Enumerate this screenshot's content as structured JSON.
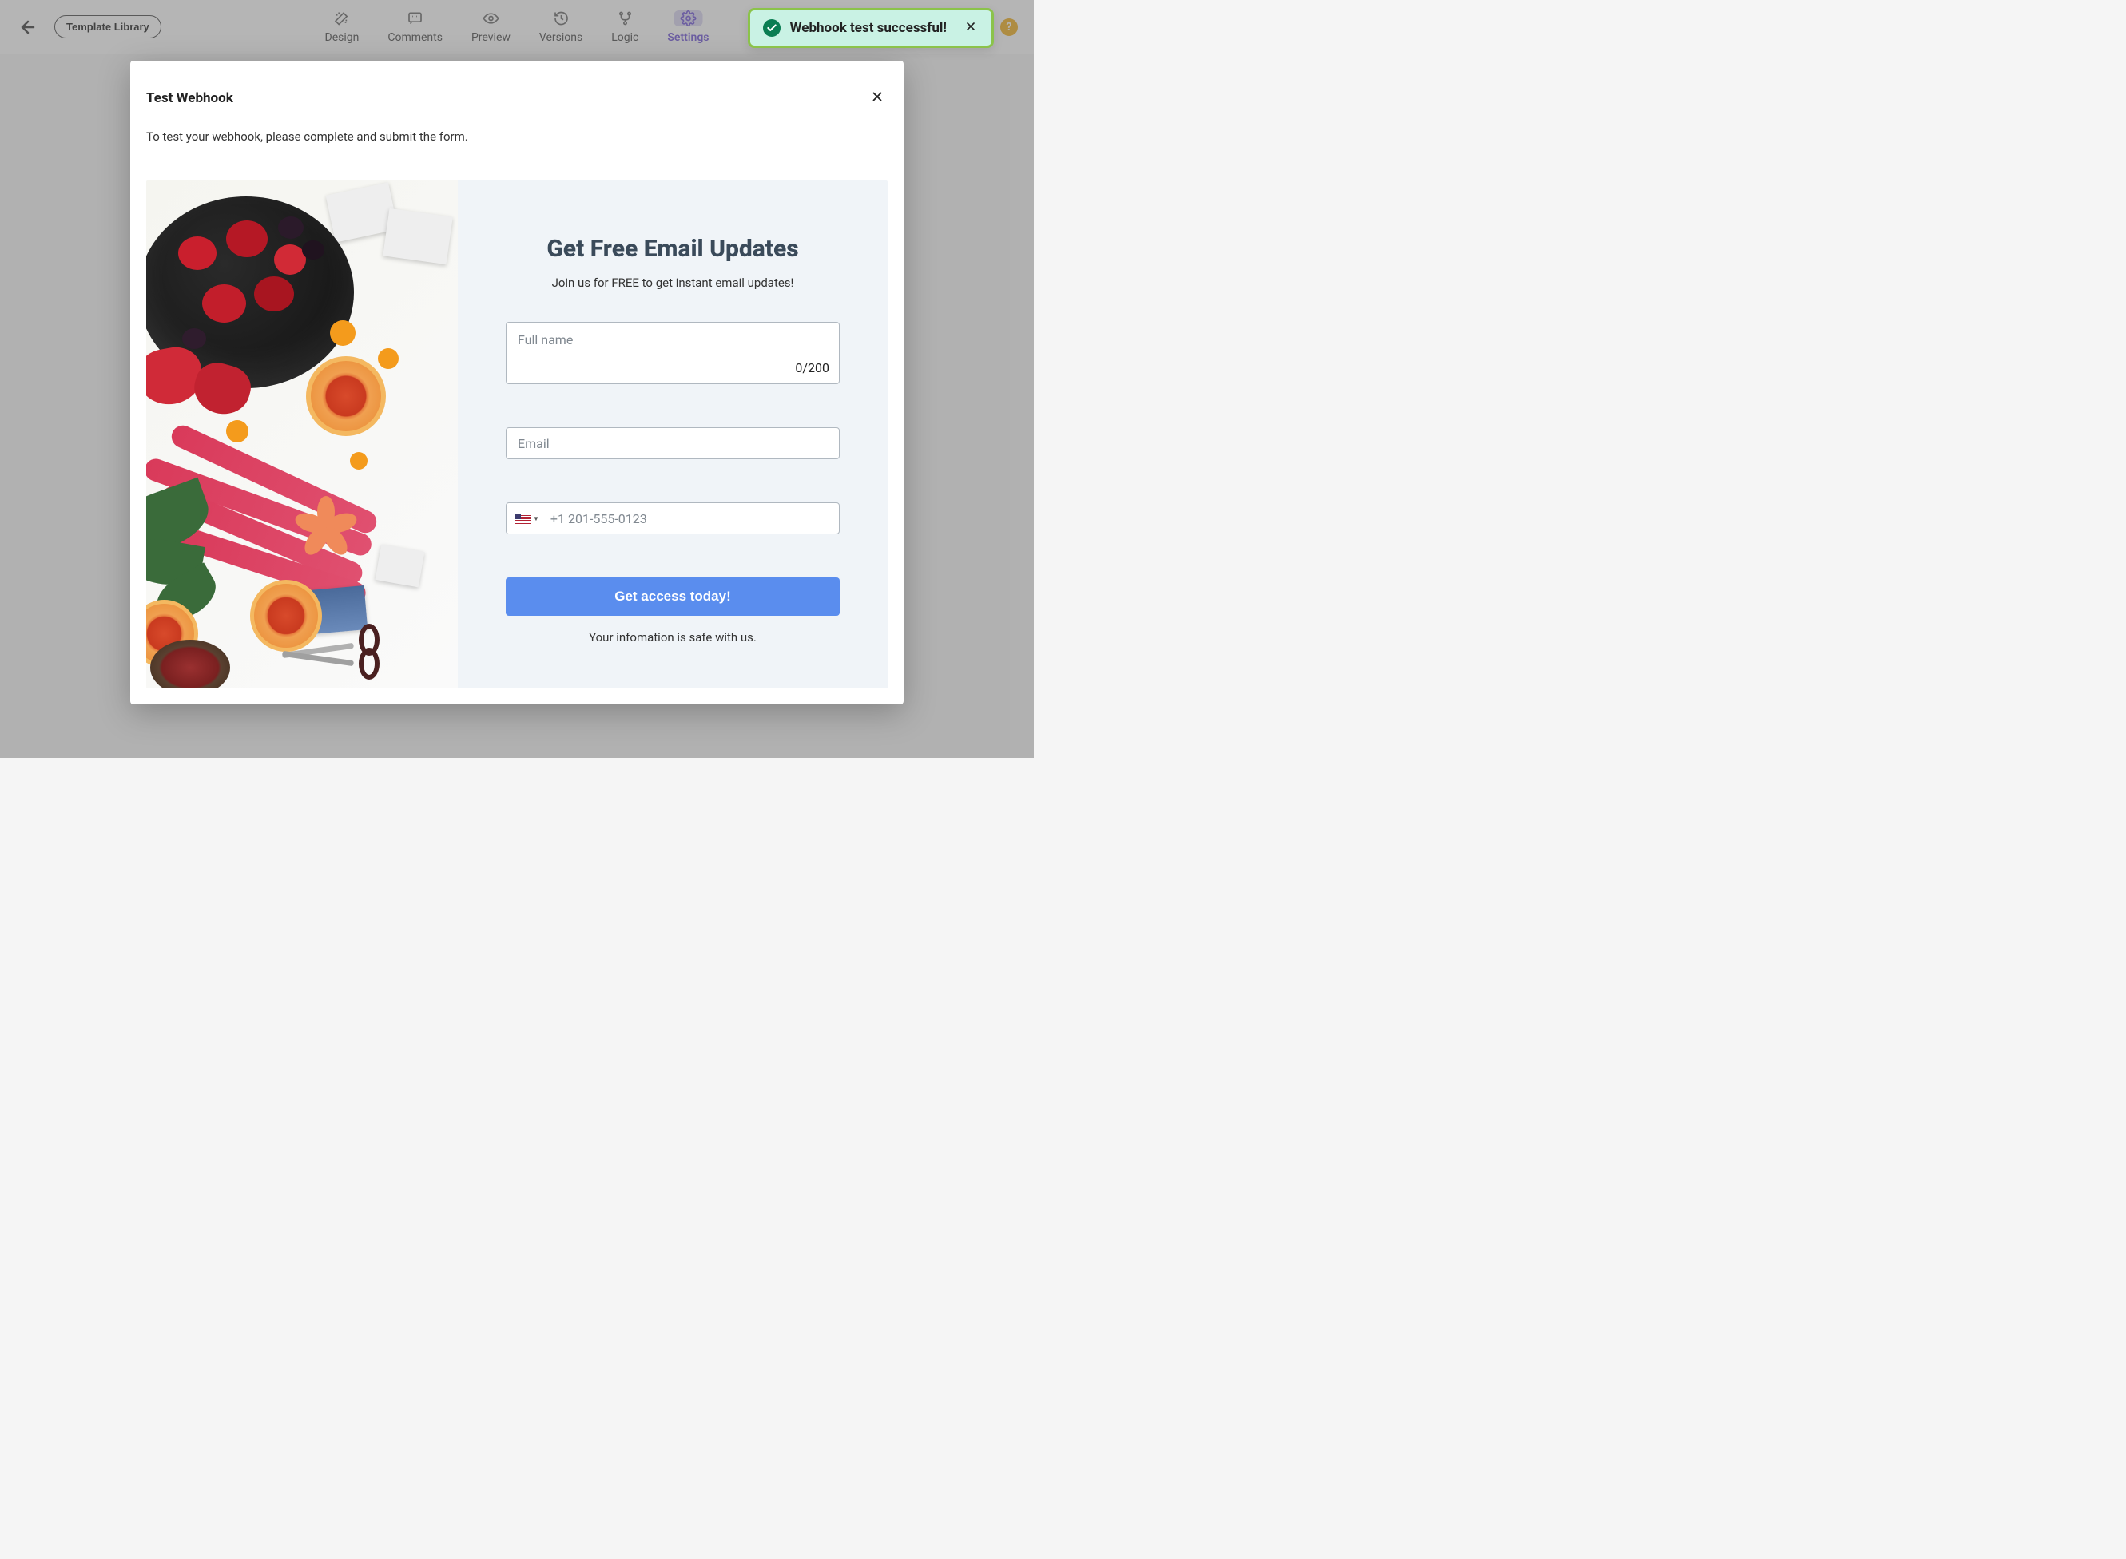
{
  "header": {
    "template_library": "Template Library",
    "tabs": [
      {
        "label": "Design",
        "icon": "wand"
      },
      {
        "label": "Comments",
        "icon": "quote"
      },
      {
        "label": "Preview",
        "icon": "eye"
      },
      {
        "label": "Versions",
        "icon": "history"
      },
      {
        "label": "Logic",
        "icon": "branch"
      },
      {
        "label": "Settings",
        "icon": "gear"
      }
    ],
    "help_glyph": "?"
  },
  "toast": {
    "message": "Webhook test successful!"
  },
  "modal": {
    "title": "Test Webhook",
    "subtitle": "To test your webhook, please complete and submit the form."
  },
  "form": {
    "title": "Get Free Email Updates",
    "subtitle": "Join us for FREE to get instant email updates!",
    "name_placeholder": "Full name",
    "name_counter": "0/200",
    "email_placeholder": "Email",
    "phone_placeholder": "+1 201-555-0123",
    "submit_label": "Get access today!",
    "safe_text": "Your infomation is safe with us."
  }
}
